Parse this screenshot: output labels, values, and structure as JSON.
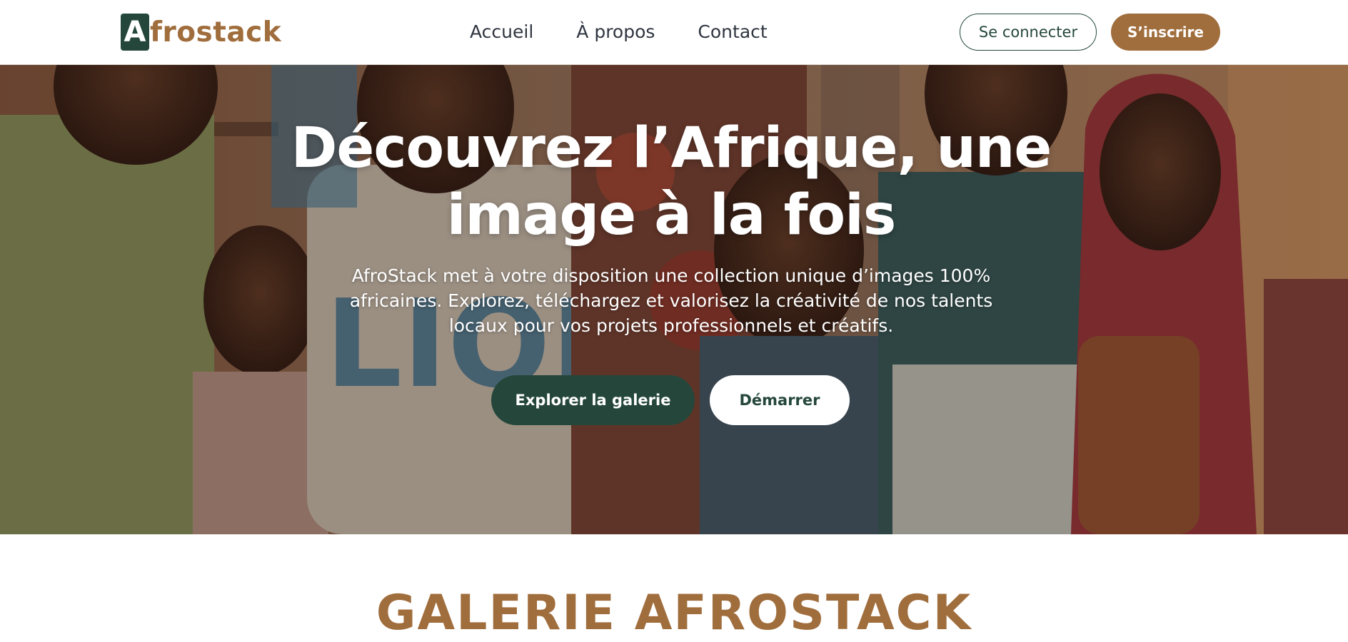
{
  "header": {
    "logo_mark": "A",
    "logo_text": "frostack",
    "nav": [
      {
        "label": "Accueil"
      },
      {
        "label": "À propos"
      },
      {
        "label": "Contact"
      }
    ],
    "login_label": "Se connecter",
    "signup_label": "S’inscrire"
  },
  "hero": {
    "title": "Découvrez l’Afrique, une image à la fois",
    "description": "AfroStack met à votre disposition une collection unique d’images 100% africaines. Explorez, téléchargez et valorisez la créativité de nos talents locaux pour vos projets professionnels et créatifs.",
    "explore_label": "Explorer la galerie",
    "start_label": "Démarrer"
  },
  "gallery": {
    "title": "GALERIE AFROSTACK"
  },
  "colors": {
    "brand_green": "#25473b",
    "brand_brown": "#a06d3c",
    "nav_text": "#2f3540"
  },
  "icons": {
    "logo": "afrostack-logo-icon"
  }
}
